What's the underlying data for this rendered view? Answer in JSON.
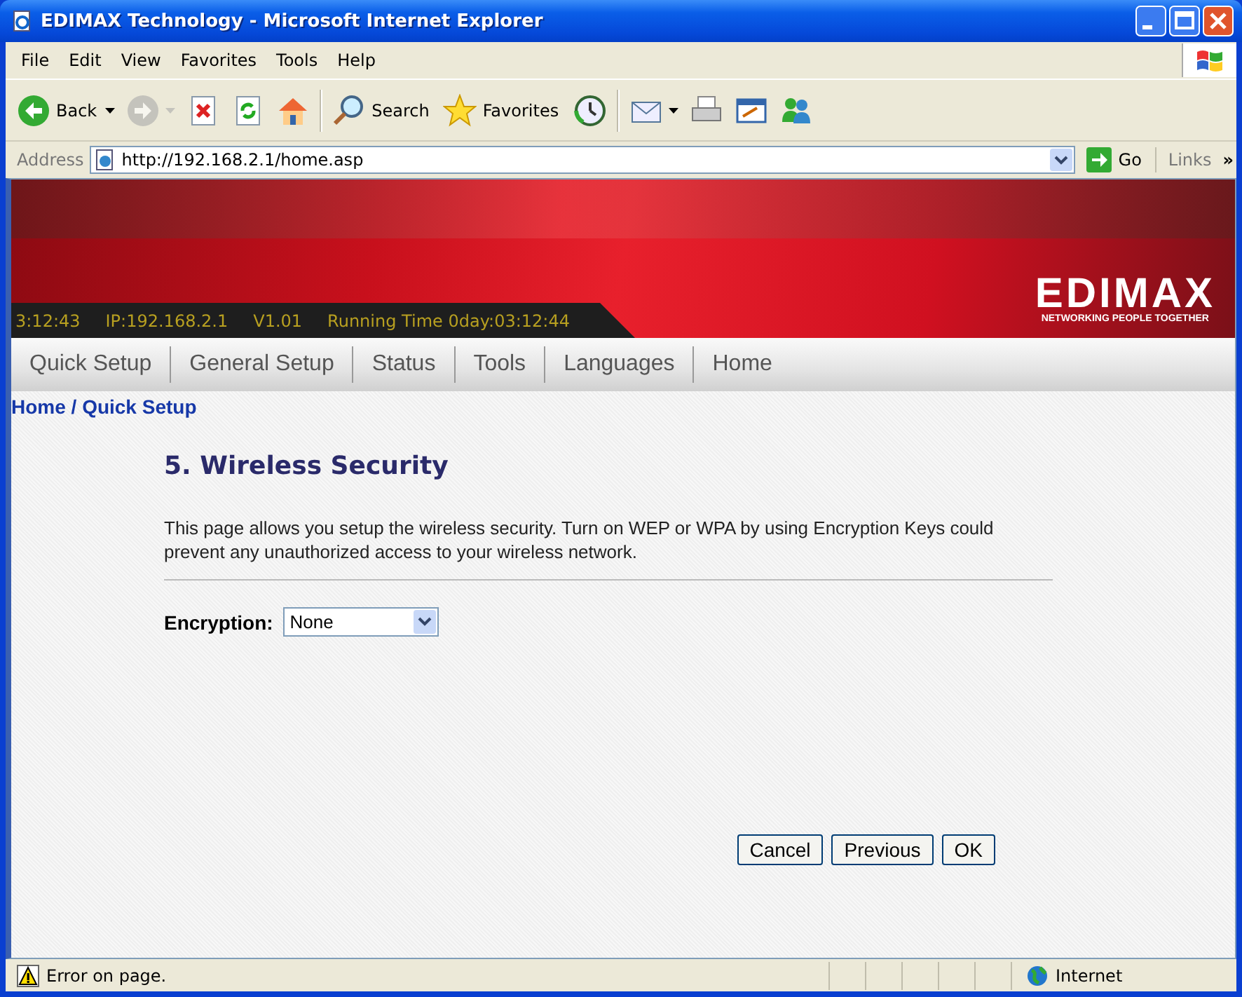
{
  "window": {
    "title": "EDIMAX Technology - Microsoft Internet Explorer"
  },
  "menu": [
    "File",
    "Edit",
    "View",
    "Favorites",
    "Tools",
    "Help"
  ],
  "toolbar": [
    [
      {
        "kind": "back",
        "label": "Back",
        "disabled": false,
        "caret": true
      },
      {
        "kind": "forward",
        "disabled": true,
        "caret": true
      },
      {
        "kind": "stop",
        "disabled": false,
        "caret": false
      },
      {
        "kind": "refresh",
        "disabled": false,
        "caret": false
      },
      {
        "kind": "home",
        "disabled": false,
        "caret": false
      }
    ],
    [
      {
        "kind": "search",
        "label": "Search",
        "disabled": false,
        "caret": false
      },
      {
        "kind": "favorites",
        "label": "Favorites",
        "disabled": false,
        "caret": false
      },
      {
        "kind": "history",
        "disabled": false,
        "caret": false
      }
    ],
    [
      {
        "kind": "mail",
        "disabled": false,
        "caret": true
      },
      {
        "kind": "print",
        "disabled": false,
        "caret": false
      },
      {
        "kind": "edit",
        "disabled": false,
        "caret": false
      },
      {
        "kind": "messenger",
        "disabled": false,
        "caret": false
      }
    ]
  ],
  "address_bar": {
    "label": "Address",
    "url": "http://192.168.2.1/home.asp",
    "go": "Go",
    "links": "Links",
    "more": "»"
  },
  "page": {
    "banner": {
      "info": [
        "3:12:43",
        "IP:192.168.2.1",
        "V1.01",
        "Running Time 0day:03:12:44"
      ],
      "logo": "EDIMAX",
      "tagline": "NETWORKING PEOPLE TOGETHER"
    },
    "nav": [
      "Quick Setup",
      "General Setup",
      "Status",
      "Tools",
      "Languages",
      "Home"
    ],
    "breadcrumb": "Home / Quick Setup",
    "heading": "5. Wireless Security",
    "description": "This page allows you setup the wireless security. Turn on WEP or WPA by using Encryption Keys could prevent any unauthorized access to your wireless network.",
    "encryption": {
      "label": "Encryption:",
      "value": "None"
    },
    "buttons": [
      "Cancel",
      "Previous",
      "OK"
    ]
  },
  "status_bar": {
    "message": "Error on page.",
    "zone": "Internet"
  }
}
